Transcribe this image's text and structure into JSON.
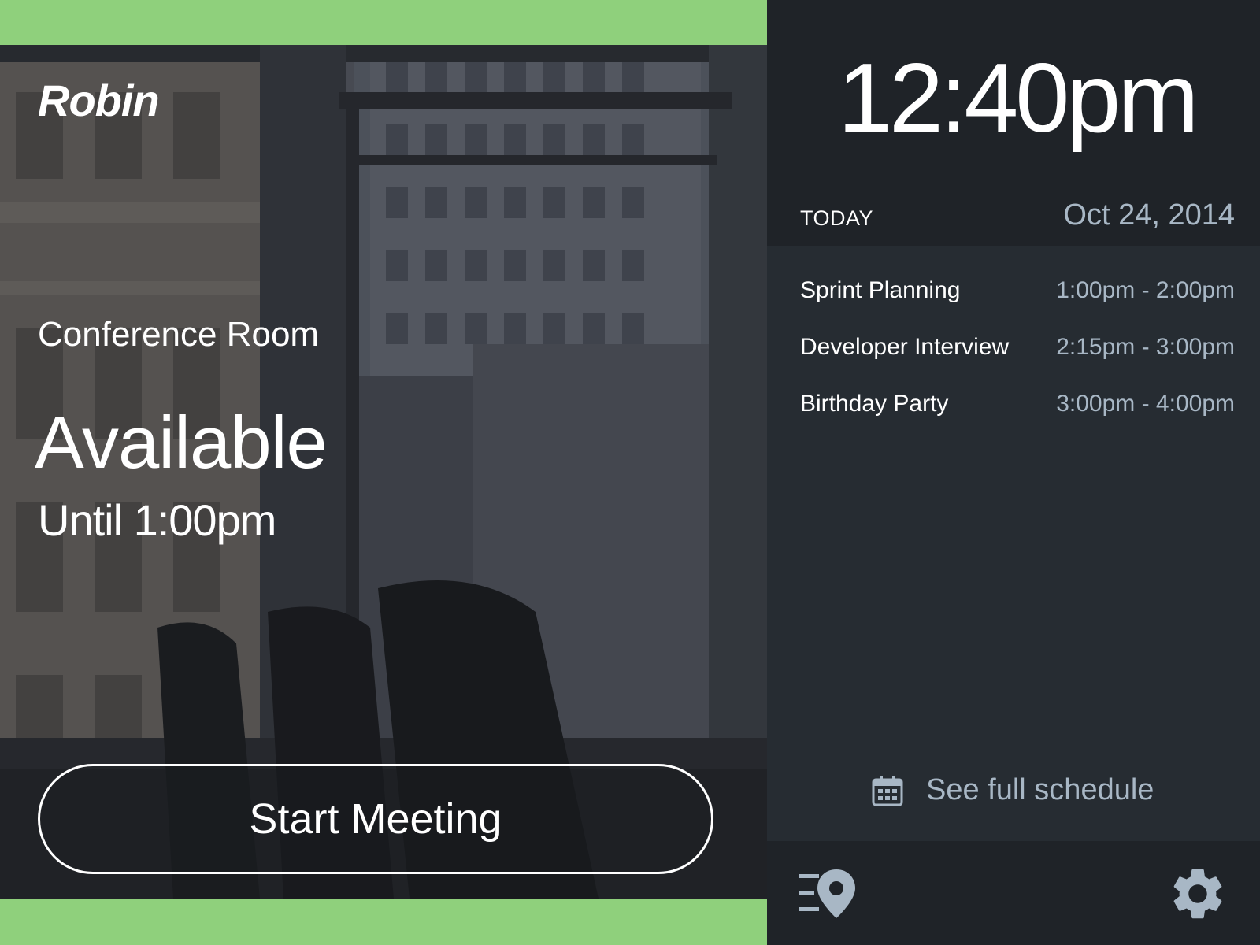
{
  "colors": {
    "accent_green": "#8fd07c",
    "panel_dark": "#1f2328",
    "panel": "#262c32",
    "muted_text": "#a8b7c5"
  },
  "brand": {
    "logo_text": "Robin"
  },
  "room": {
    "name": "Conference Room",
    "status": "Available",
    "until": "Until 1:00pm"
  },
  "actions": {
    "start_meeting_label": "Start Meeting"
  },
  "clock": {
    "time": "12:40pm"
  },
  "schedule": {
    "day_label": "TODAY",
    "date": "Oct 24, 2014",
    "events": [
      {
        "title": "Sprint Planning",
        "time": "1:00pm - 2:00pm"
      },
      {
        "title": "Developer Interview",
        "time": "2:15pm - 3:00pm"
      },
      {
        "title": "Birthday Party",
        "time": "3:00pm - 4:00pm"
      }
    ],
    "full_schedule_label": "See full schedule",
    "full_schedule_icon": "calendar-icon"
  },
  "footer": {
    "left_icon": "find-room-icon",
    "right_icon": "gear-icon"
  }
}
